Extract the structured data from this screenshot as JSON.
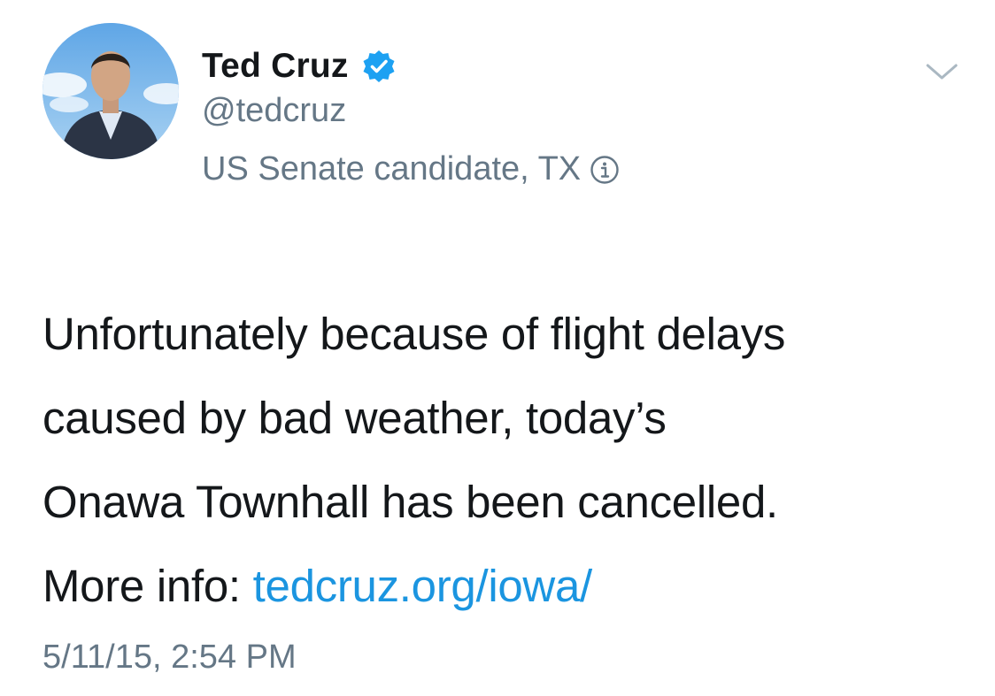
{
  "author": {
    "display_name": "Ted Cruz",
    "handle": "@tedcruz",
    "label": "US Senate candidate, TX",
    "verified": true
  },
  "tweet": {
    "lines": [
      "Unfortunately because of flight delays",
      "caused by bad weather, today’s",
      "Onawa Townhall has been cancelled."
    ],
    "more_info_prefix": "More info: ",
    "link_text": "tedcruz.org/iowa/",
    "timestamp": "5/11/15, 2:54 PM"
  },
  "icons": {
    "verified": "verified-badge-icon",
    "info": "info-icon",
    "menu": "chevron-down-icon"
  },
  "colors": {
    "text": "#14171a",
    "secondary": "#657786",
    "link": "#1b95e0",
    "verified": "#1da1f2"
  }
}
